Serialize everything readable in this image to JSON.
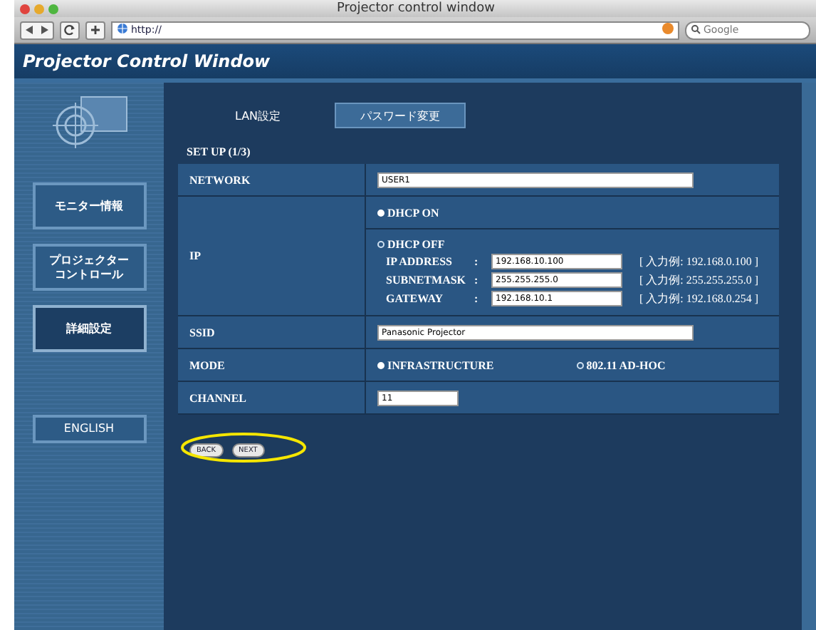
{
  "browser": {
    "title": "Projector control window",
    "address": "http://",
    "search_placeholder": "Google"
  },
  "header": {
    "title": "Projector Control Window"
  },
  "sidebar": {
    "items": [
      {
        "lines": [
          "モニター情報"
        ],
        "selected": false
      },
      {
        "lines": [
          "プロジェクター",
          "コントロール"
        ],
        "selected": false
      },
      {
        "lines": [
          "詳細設定"
        ],
        "selected": true
      },
      {
        "lines": [
          "ENGLISH"
        ],
        "selected": false
      }
    ]
  },
  "tabs": [
    {
      "label": "LAN設定",
      "selected": true
    },
    {
      "label": "パスワード変更",
      "selected": false
    }
  ],
  "section_title": "SET UP (1/3)",
  "rows": [
    {
      "kind": "text",
      "label": "NETWORK",
      "value": "USER1"
    },
    {
      "kind": "ip",
      "label": "IP",
      "options": [
        {
          "label": "DHCP ON",
          "selected": true
        },
        {
          "label": "DHCP OFF",
          "selected": false
        }
      ],
      "fields": [
        {
          "label": "IP ADDRESS",
          "separator": ":",
          "value": "192.168.10.100",
          "example": "[ 入力例: 192.168.0.100 ]"
        },
        {
          "label": "SUBNETMASK",
          "separator": ":",
          "value": "255.255.255.0",
          "example": "[ 入力例: 255.255.255.0 ]"
        },
        {
          "label": "GATEWAY",
          "separator": ":",
          "value": "192.168.10.1",
          "example": "[ 入力例: 192.168.0.254 ]"
        }
      ]
    },
    {
      "kind": "text",
      "label": "SSID",
      "value": "Panasonic Projector"
    },
    {
      "kind": "radio",
      "label": "MODE",
      "options": [
        {
          "label": "INFRASTRUCTURE",
          "selected": true
        },
        {
          "label": "802.11 AD-HOC",
          "selected": false
        }
      ]
    },
    {
      "kind": "short",
      "label": "CHANNEL",
      "value": "11"
    }
  ],
  "buttons": [
    {
      "label": "BACK"
    },
    {
      "label": "NEXT"
    }
  ]
}
